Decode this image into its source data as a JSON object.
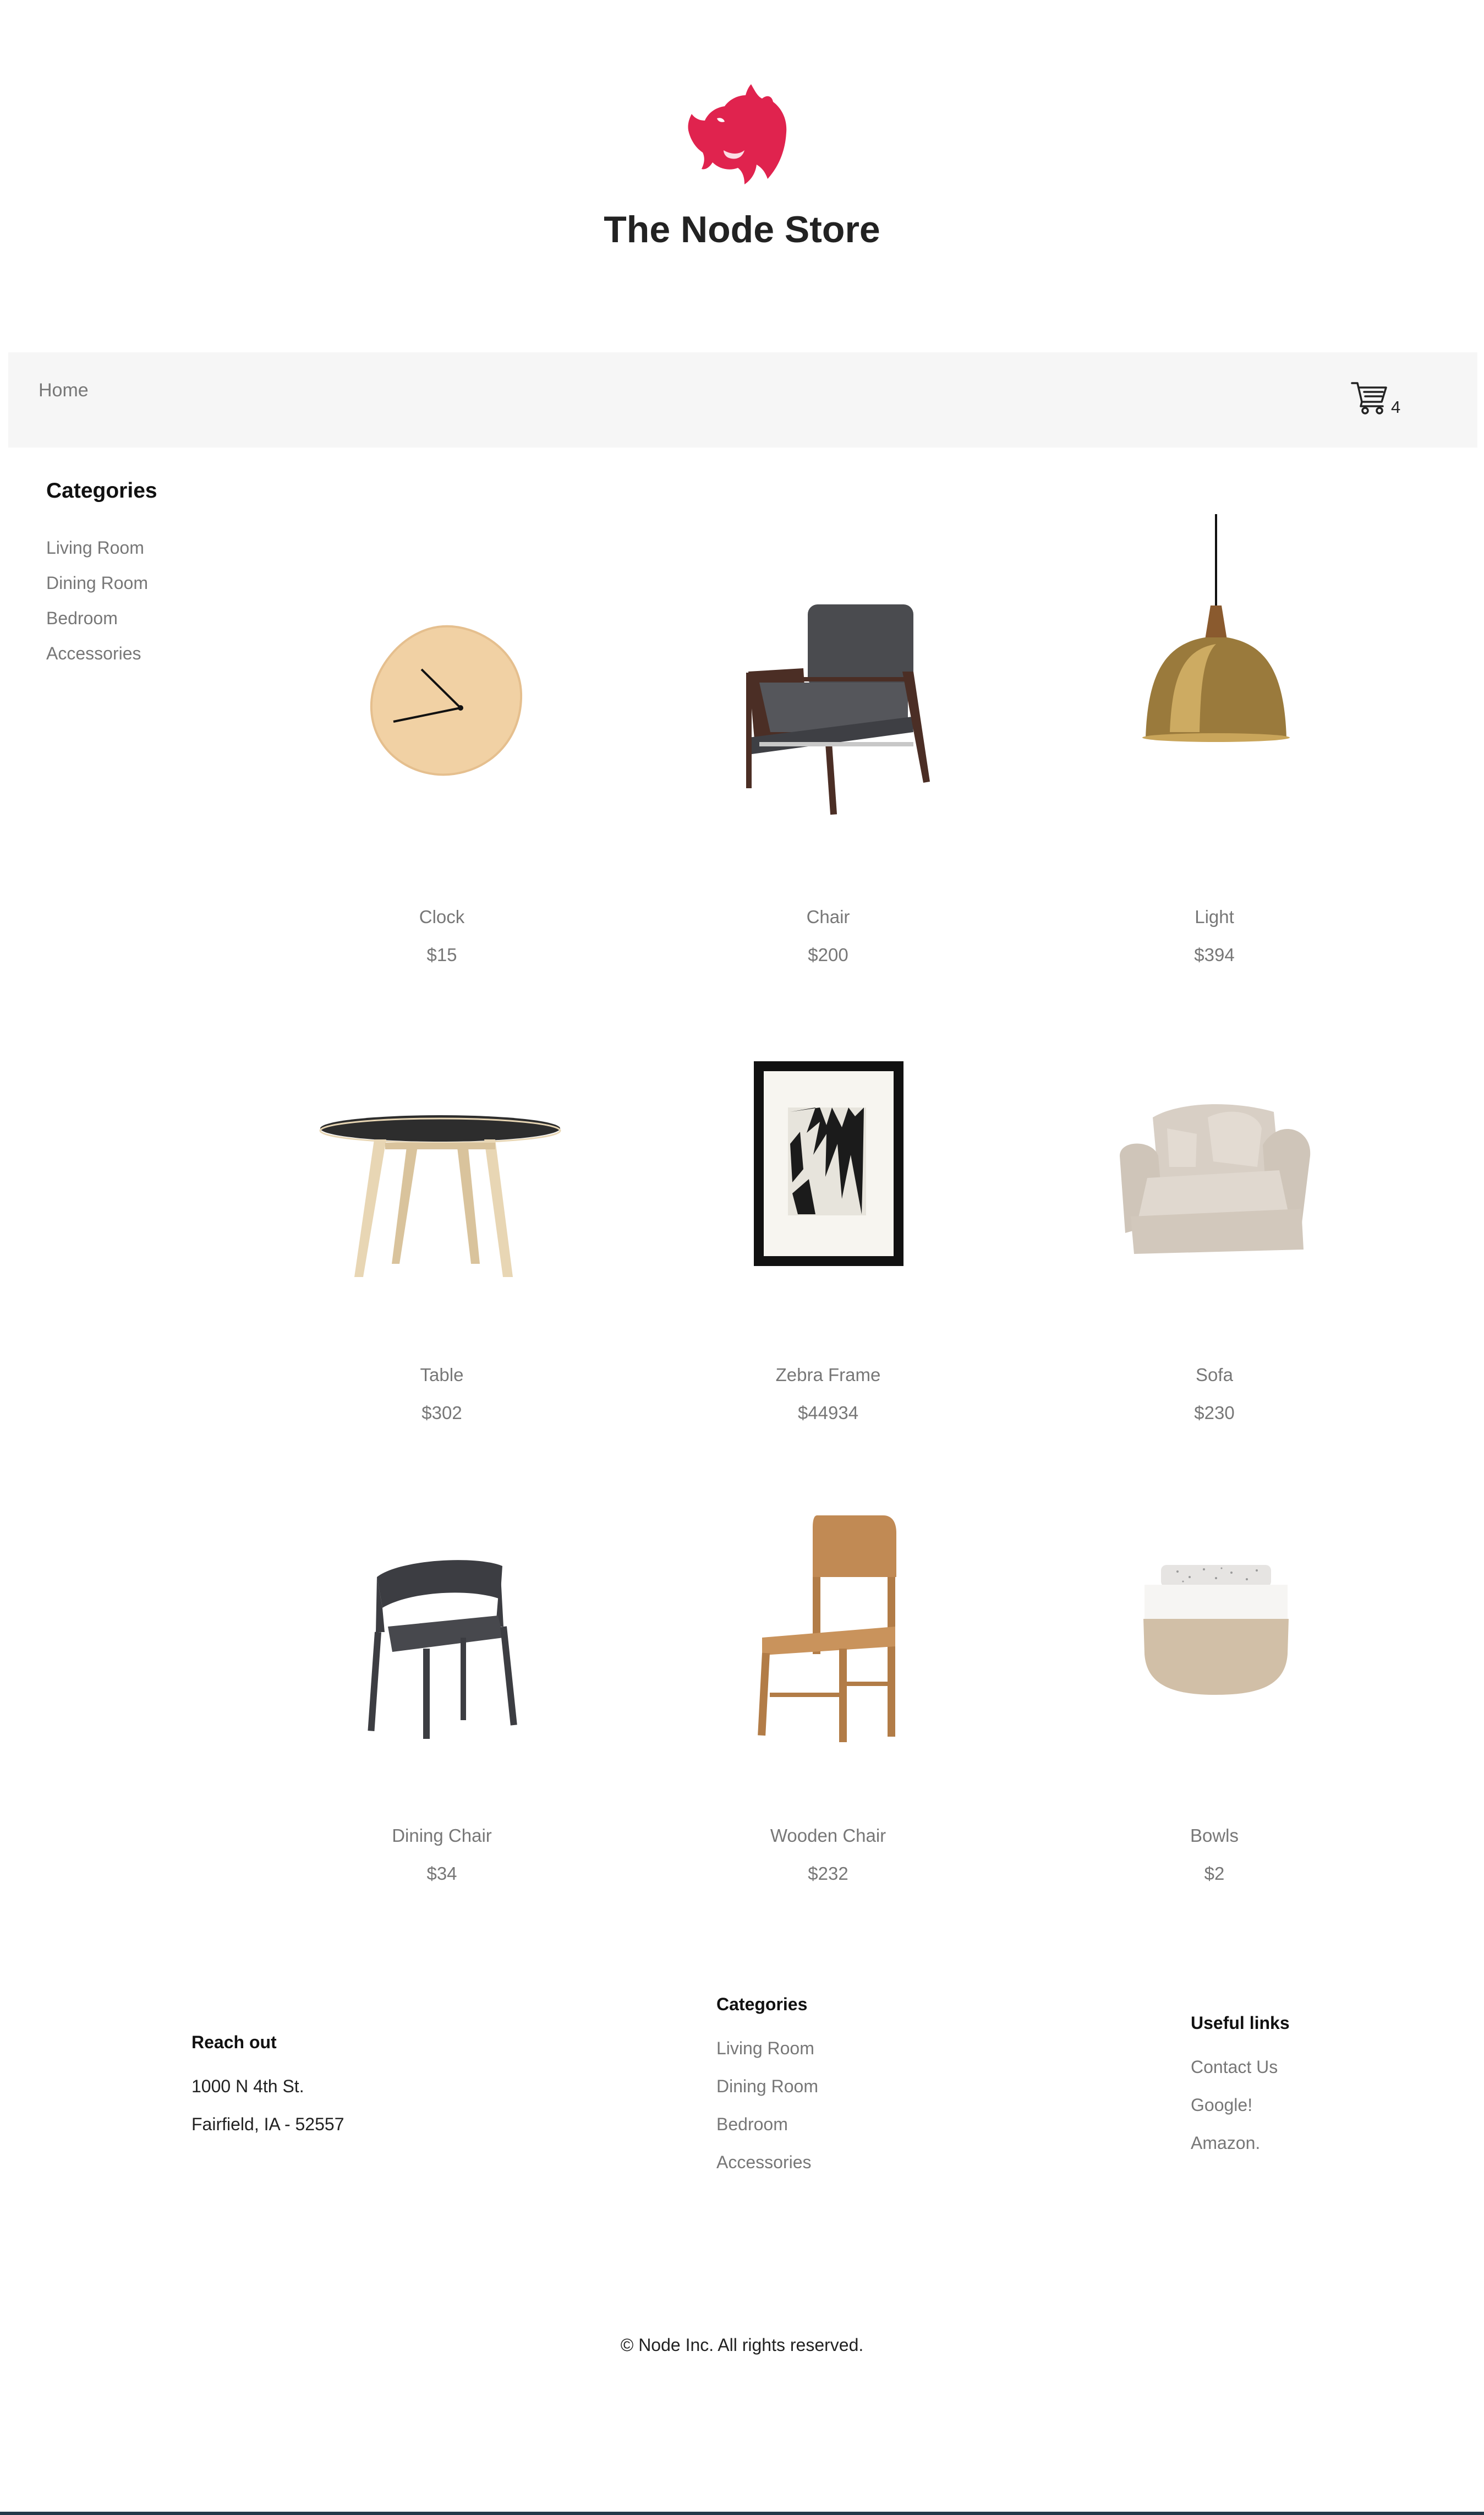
{
  "header": {
    "store_title": "The Node Store",
    "logo_color": "#e0234e"
  },
  "nav": {
    "home_label": "Home",
    "cart_count": "4"
  },
  "sidebar": {
    "heading": "Categories",
    "items": [
      "Living Room",
      "Dining Room",
      "Bedroom",
      "Accessories"
    ]
  },
  "products": [
    {
      "name": "Clock",
      "price": "$15"
    },
    {
      "name": "Chair",
      "price": "$200"
    },
    {
      "name": "Light",
      "price": "$394"
    },
    {
      "name": "Table",
      "price": "$302"
    },
    {
      "name": "Zebra Frame",
      "price": "$44934"
    },
    {
      "name": "Sofa",
      "price": "$230"
    },
    {
      "name": "Dining Chair",
      "price": "$34"
    },
    {
      "name": "Wooden Chair",
      "price": "$232"
    },
    {
      "name": "Bowls",
      "price": "$2"
    }
  ],
  "footer": {
    "reach_out": {
      "heading": "Reach out",
      "address_line1": "1000 N 4th St.",
      "address_line2": "Fairfield, IA - 52557"
    },
    "categories": {
      "heading": "Categories",
      "items": [
        "Living Room",
        "Dining Room",
        "Bedroom",
        "Accessories"
      ]
    },
    "useful_links": {
      "heading": "Useful links",
      "items": [
        "Contact Us",
        "Google!",
        "Amazon."
      ]
    },
    "copyright": "© Node Inc. All rights reserved."
  }
}
